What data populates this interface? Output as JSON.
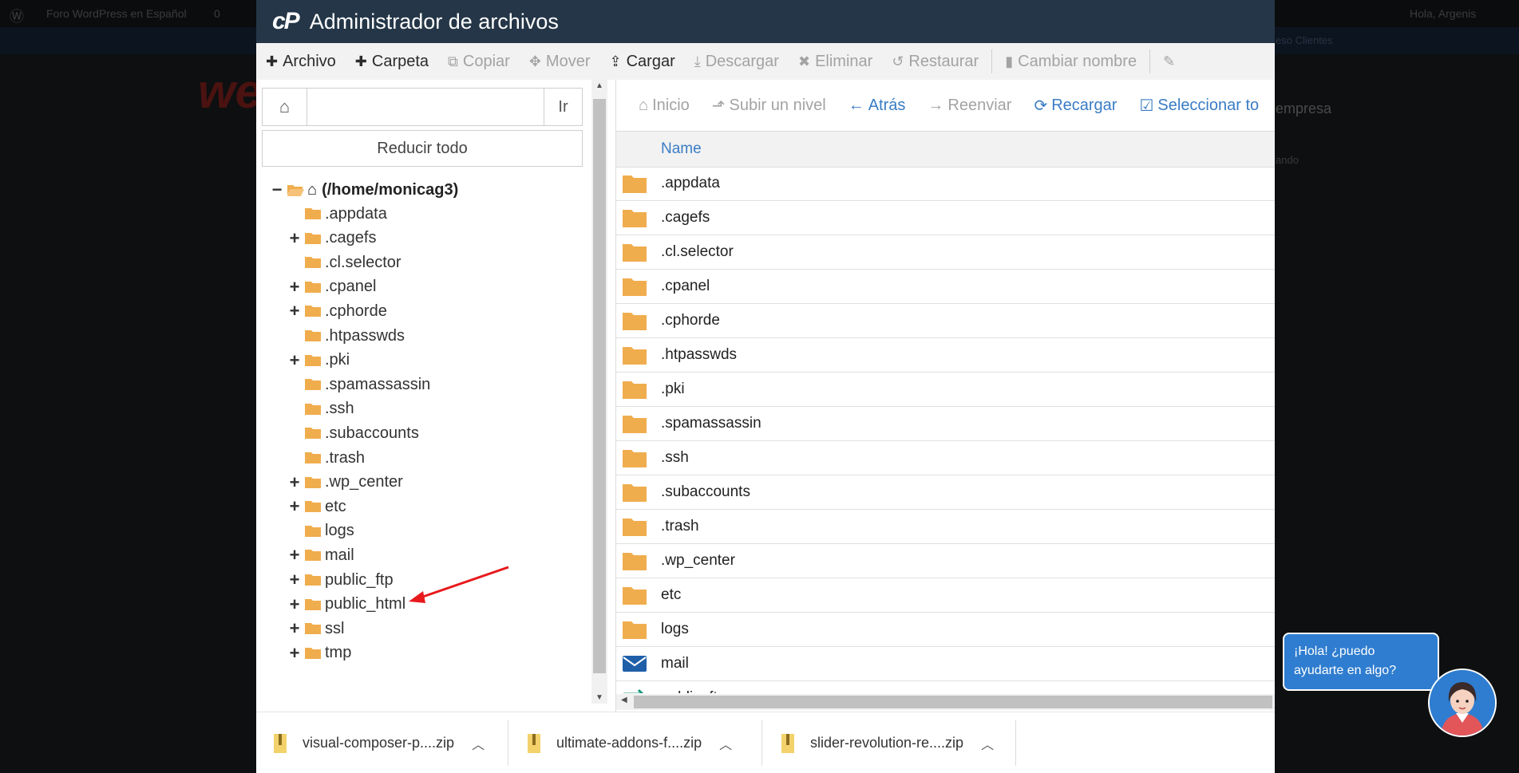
{
  "background": {
    "admin_bar_site": "Foro WordPress en Español",
    "admin_bar_comments": "0",
    "admin_bar_greeting": "Hola, Argenis",
    "strip_link": "eso Clientes",
    "side_text": "empresa",
    "side_small": "ando"
  },
  "file_manager": {
    "title": "Administrador de archivos",
    "toolbar": [
      {
        "label": "Archivo",
        "icon": "plus-icon",
        "enabled": true
      },
      {
        "label": "Carpeta",
        "icon": "plus-icon",
        "enabled": true
      },
      {
        "label": "Copiar",
        "icon": "copy-icon",
        "enabled": false
      },
      {
        "label": "Mover",
        "icon": "move-icon",
        "enabled": false
      },
      {
        "label": "Cargar",
        "icon": "upload-icon",
        "enabled": true
      },
      {
        "label": "Descargar",
        "icon": "download-icon",
        "enabled": false
      },
      {
        "label": "Eliminar",
        "icon": "delete-icon",
        "enabled": false
      },
      {
        "label": "Restaurar",
        "icon": "restore-icon",
        "enabled": false
      },
      {
        "label": "Cambiar nombre",
        "icon": "file-icon",
        "enabled": false
      }
    ],
    "path_input": {
      "value": "",
      "go_label": "Ir"
    },
    "collapse_all_label": "Reducir todo",
    "tree": {
      "root_label": "(/home/monicag3)",
      "items": [
        {
          "name": ".appdata",
          "expandable": false
        },
        {
          "name": ".cagefs",
          "expandable": true
        },
        {
          "name": ".cl.selector",
          "expandable": false
        },
        {
          "name": ".cpanel",
          "expandable": true
        },
        {
          "name": ".cphorde",
          "expandable": true
        },
        {
          "name": ".htpasswds",
          "expandable": false
        },
        {
          "name": ".pki",
          "expandable": true
        },
        {
          "name": ".spamassassin",
          "expandable": false
        },
        {
          "name": ".ssh",
          "expandable": false
        },
        {
          "name": ".subaccounts",
          "expandable": false
        },
        {
          "name": ".trash",
          "expandable": false
        },
        {
          "name": ".wp_center",
          "expandable": true
        },
        {
          "name": "etc",
          "expandable": true
        },
        {
          "name": "logs",
          "expandable": false
        },
        {
          "name": "mail",
          "expandable": true
        },
        {
          "name": "public_ftp",
          "expandable": true
        },
        {
          "name": "public_html",
          "expandable": true
        },
        {
          "name": "ssl",
          "expandable": true
        },
        {
          "name": "tmp",
          "expandable": true
        }
      ]
    },
    "nav": [
      {
        "label": "Inicio",
        "icon": "home-icon",
        "enabled": false
      },
      {
        "label": "Subir un nivel",
        "icon": "level-up-icon",
        "enabled": false
      },
      {
        "label": "Atrás",
        "icon": "arrow-left-icon",
        "enabled": true
      },
      {
        "label": "Reenviar",
        "icon": "arrow-right-icon",
        "enabled": false
      },
      {
        "label": "Recargar",
        "icon": "refresh-icon",
        "enabled": true
      },
      {
        "label": "Seleccionar to",
        "icon": "checkbox-icon",
        "enabled": true
      }
    ],
    "grid_header": {
      "name_label": "Name"
    },
    "files": [
      {
        "name": ".appdata",
        "type": "folder"
      },
      {
        "name": ".cagefs",
        "type": "folder"
      },
      {
        "name": ".cl.selector",
        "type": "folder"
      },
      {
        "name": ".cpanel",
        "type": "folder"
      },
      {
        "name": ".cphorde",
        "type": "folder"
      },
      {
        "name": ".htpasswds",
        "type": "folder"
      },
      {
        "name": ".pki",
        "type": "folder"
      },
      {
        "name": ".spamassassin",
        "type": "folder"
      },
      {
        "name": ".ssh",
        "type": "folder"
      },
      {
        "name": ".subaccounts",
        "type": "folder"
      },
      {
        "name": ".trash",
        "type": "folder"
      },
      {
        "name": ".wp_center",
        "type": "folder"
      },
      {
        "name": "etc",
        "type": "folder"
      },
      {
        "name": "logs",
        "type": "folder"
      },
      {
        "name": "mail",
        "type": "mail"
      },
      {
        "name": "public_ftp",
        "type": "ftp"
      }
    ]
  },
  "downloads": [
    {
      "name": "visual-composer-p....zip"
    },
    {
      "name": "ultimate-addons-f....zip"
    },
    {
      "name": "slider-revolution-re....zip"
    }
  ],
  "chat": {
    "message": "¡Hola! ¿puedo ayudarte en algo?"
  },
  "colors": {
    "title_bar": "#243647",
    "folder": "#f0ad4e",
    "link_blue": "#3a7cc4",
    "disabled": "#a3a3a3",
    "annotation_arrow": "#e8191c",
    "chat_blue": "#2f7dd0"
  }
}
